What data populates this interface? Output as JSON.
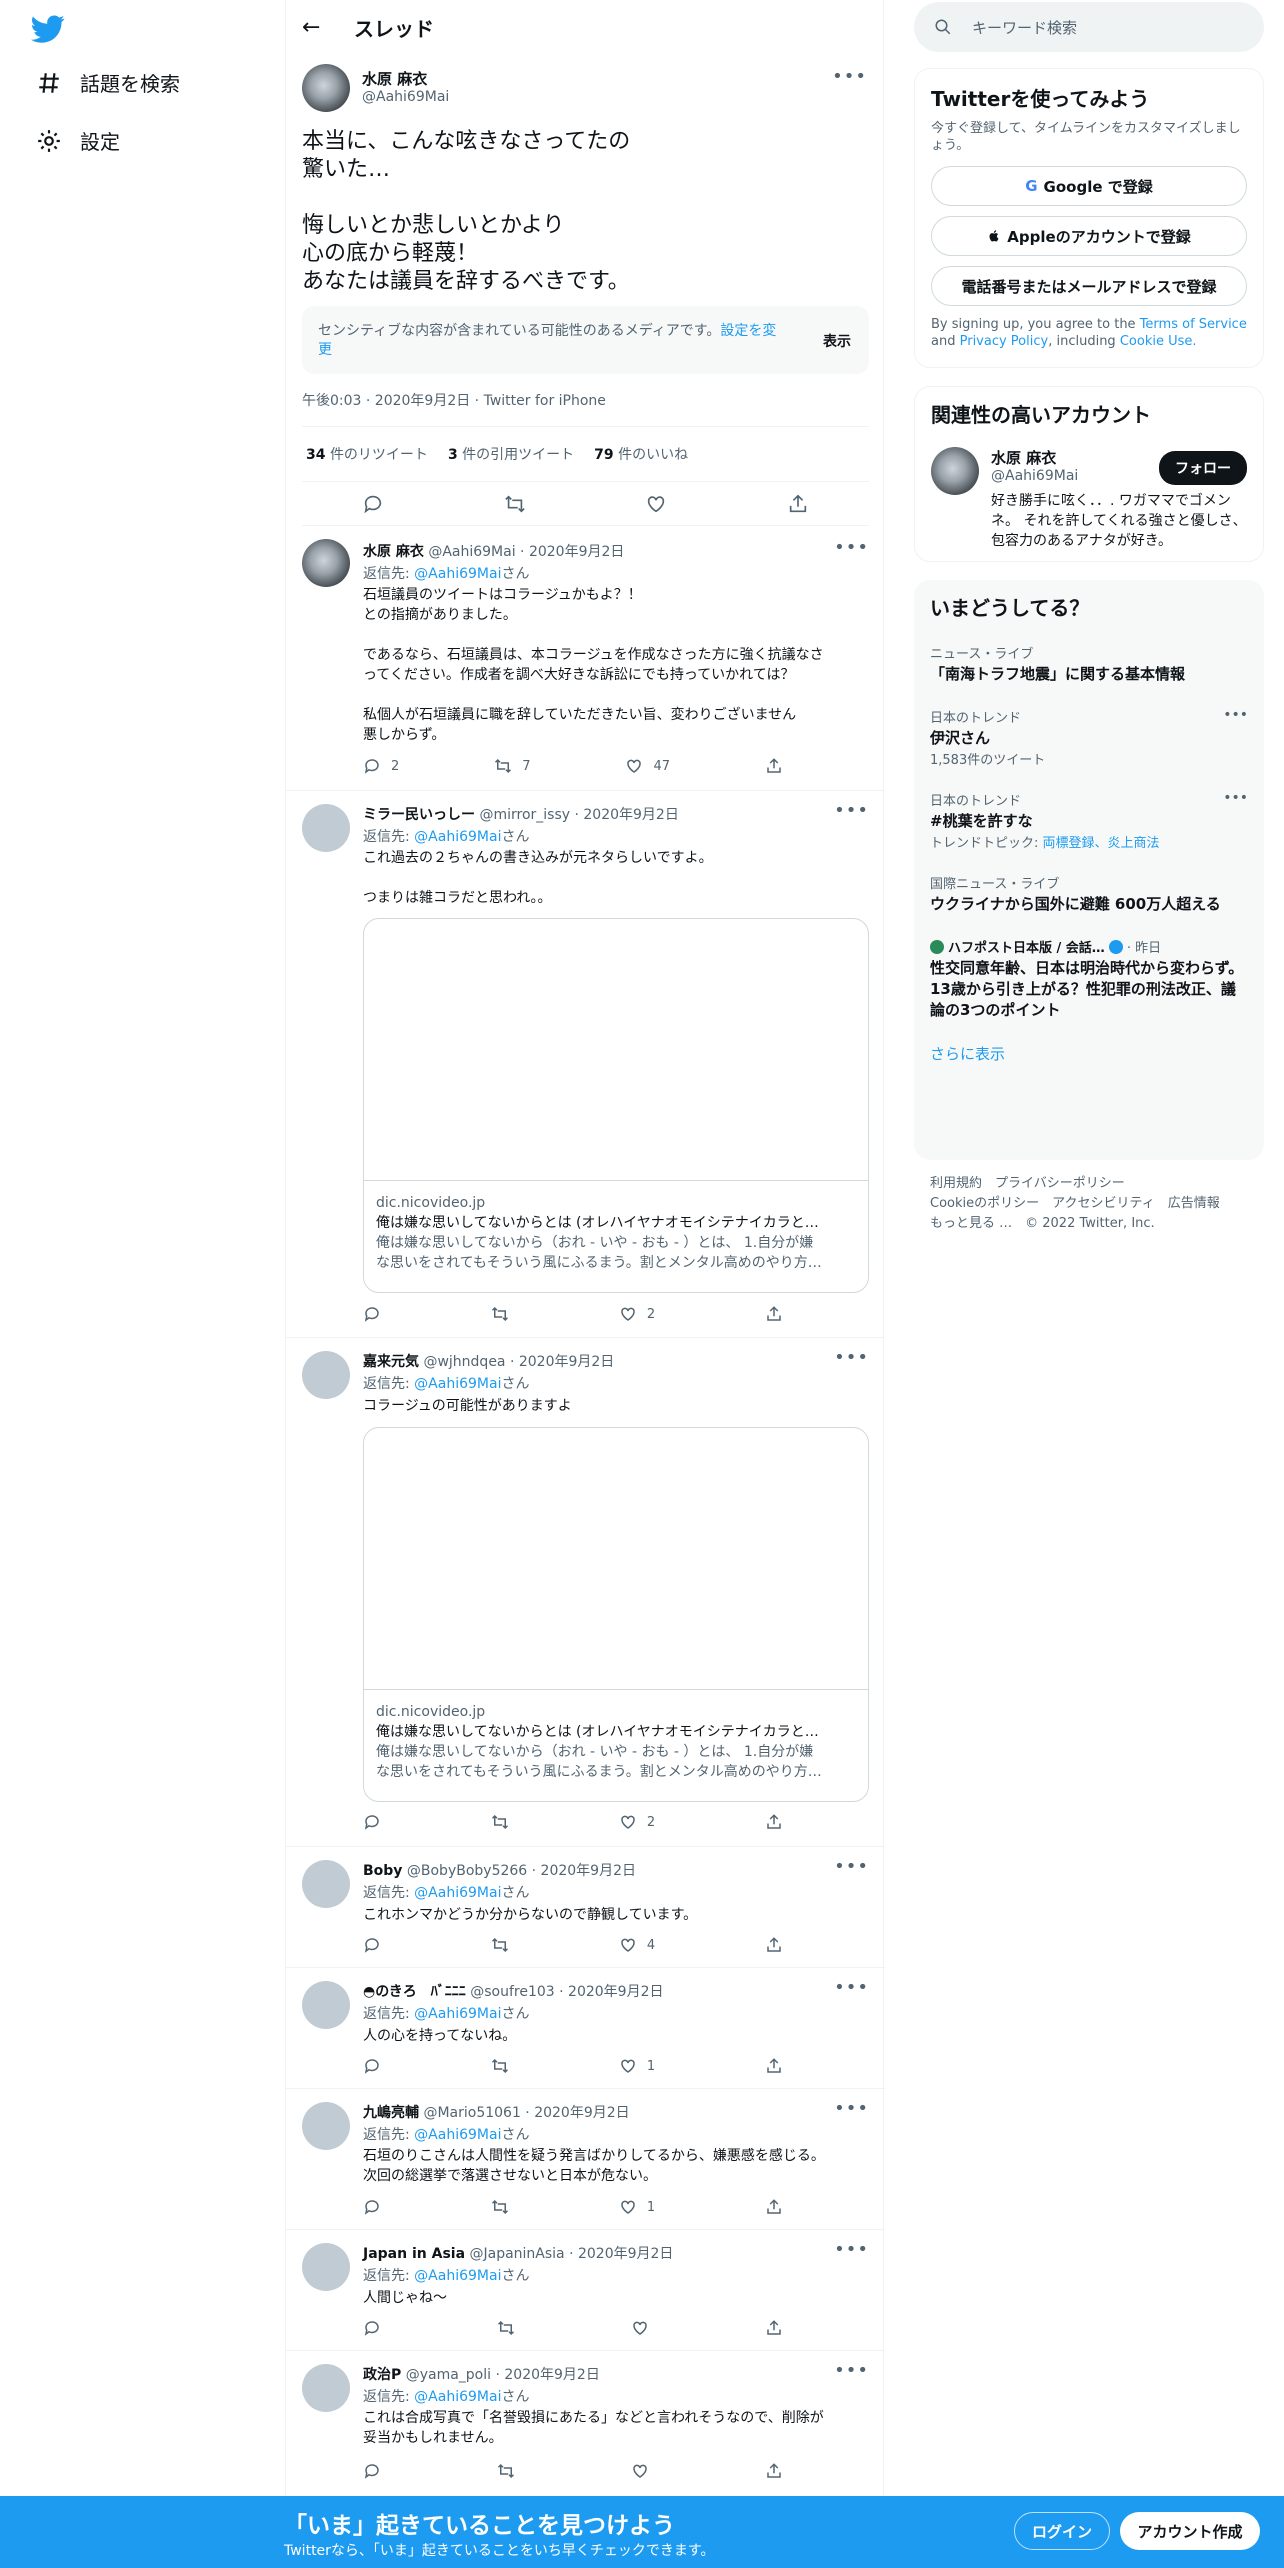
{
  "nav": {
    "explore": "話題を検索",
    "settings": "設定"
  },
  "header": {
    "back": "←",
    "title": "スレッド"
  },
  "main_tweet": {
    "name": "水原 麻衣",
    "handle": "@Aahi69Mai",
    "line1": "本当に、こんな呟きなさってたの",
    "line2": "驚いた…",
    "line3": "悔しいとか悲しいとかより",
    "line4": "心の底から軽蔑！",
    "line5": "あなたは議員を辞するべきです。",
    "sensitive": "センシティブな内容が含まれている可能性のあるメディアです。",
    "sensitive_link": "設定を変更",
    "show": "表示",
    "meta": "午後0:03 · 2020年9月2日 · Twitter for iPhone",
    "rt_count": "34",
    "rt_label": "件のリツイート",
    "qt_count": "3",
    "qt_label": "件の引用ツイート",
    "like_count": "79",
    "like_label": "件のいいね"
  },
  "reply_to": "返信先:",
  "reply_handle": "@Aahi69Mai",
  "reply_suffix": "さん",
  "replies": [
    {
      "name": "水原 麻衣",
      "meta": "@Aahi69Mai · 2020年9月2日",
      "lines": [
        "石垣議員のツイートはコラージュかもよ？！",
        "との指摘がありました。",
        "",
        "であるなら、石垣議員は、本コラージュを作成なさった方に強く抗議なさ",
        "ってください。作成者を調べ大好きな訴訟にでも持っていかれては？",
        "",
        "私個人が石垣議員に職を辞していただきたい旨、変わりございません",
        "悪しからず。"
      ],
      "reply": "2",
      "rt": "7",
      "like": "47"
    },
    {
      "name": "ミラー民いっしー",
      "meta": "@mirror_issy · 2020年9月2日",
      "lines": [
        "これ過去の２ちゃんの書き込みが元ネタらしいですよ。",
        "",
        "つまりは雑コラだと思われ。。"
      ],
      "like": "2"
    },
    {
      "name": "嘉来元気",
      "meta": "@wjhndqea · 2020年9月2日",
      "lines": [
        "コラージュの可能性がありますよ"
      ],
      "like": "2"
    },
    {
      "name": "Boby",
      "meta": "@BobyBoby5266 · 2020年9月2日",
      "lines": [
        "これホンマかどうか分からないので静観しています。"
      ],
      "like": "4"
    },
    {
      "name": "◓のきろ　ﾊﾞﾆﾆﾆ",
      "meta": "@soufre103 · 2020年9月2日",
      "lines": [
        "人の心を持ってないね。"
      ],
      "like": "1"
    },
    {
      "name": "九嶋亮輔",
      "meta": "@Mario51061 · 2020年9月2日",
      "lines": [
        "石垣のりこさんは人間性を疑う発言ばかりしてるから、嫌悪感を感じる。",
        "次回の総選挙で落選させないと日本が危ない。"
      ],
      "like": "1"
    },
    {
      "name": "Japan in Asia",
      "meta": "@JapaninAsia · 2020年9月2日",
      "lines": [
        "人間じゃね〜"
      ]
    },
    {
      "name": "政治P",
      "meta": "@yama_poli · 2020年9月2日",
      "lines": [
        "これは合成写真で「名誉毀損にあたる」などと言われそうなので、削除が",
        "妥当かもしれません。"
      ]
    }
  ],
  "link_card": {
    "domain": "dic.nicovideo.jp",
    "title": "俺は嫌な思いしてないからとは (オレハイヤナオモイシテナイカラと…",
    "desc1": "俺は嫌な思いしてないから（おれ - いや - おも - ）とは、 1.自分が嫌",
    "desc2": "な思いをされてもそういう風にふるまう。割とメンタル高めのやり方…"
  },
  "search": {
    "placeholder": "キーワード検索"
  },
  "signup": {
    "title": "Twitterを使ってみよう",
    "sub": "今すぐ登録して、タイムラインをカスタマイズしましょう。",
    "google": "Google で登録",
    "apple": "Appleのアカウントで登録",
    "phone": "電話番号またはメールアドレスで登録",
    "legal1": "By signing up, you agree to the",
    "tos": "Terms of Service",
    "and": "and",
    "privacy": "Privacy Policy",
    "legal2": ", including",
    "cookie": "Cookie Use."
  },
  "related": {
    "title": "関連性の高いアカウント",
    "name": "水原 麻衣",
    "handle": "@Aahi69Mai",
    "follow": "フォロー",
    "bio": "好き勝手に呟く．．. ワガママでゴメンネ。 それを許してくれる強さと優しさ、包容力のあるアナタが好き。"
  },
  "trends": {
    "title": "いまどうしてる？",
    "items": [
      {
        "cat": "ニュース・ライブ",
        "title": "「南海トラフ地震」に関する基本情報"
      },
      {
        "cat": "日本のトレンド",
        "title": "伊沢さん",
        "sub": "1,583件のツイート"
      },
      {
        "cat": "日本のトレンド",
        "title": "#桃葉を許すな",
        "sub_prefix": "トレンドトピック:",
        "sub_links": "両標登録、炎上商法"
      },
      {
        "cat": "国際ニュース・ライブ",
        "title": "ウクライナから国外に避難 600万人超える"
      },
      {
        "cat": "ハフポスト日本版 / 会話…",
        "cat_suffix": "· 昨日",
        "title": "性交同意年齢、日本は明治時代から変わらず。13歳から引き上がる？性犯罪の刑法改正、議論の3つのポイント"
      }
    ],
    "more": "さらに表示"
  },
  "footer": {
    "l1": "利用規約　プライバシーポリシー",
    "l2": "Cookieのポリシー　アクセシビリティ　広告情報",
    "l3": "もっと見る …　© 2022 Twitter, Inc."
  },
  "banner": {
    "title": "「いま」起きていることを見つけよう",
    "sub": "Twitterなら、「いま」起きていることをいち早くチェックできます。",
    "login": "ログイン",
    "signup": "アカウント作成"
  },
  "colors": {
    "accent": "#1d9bf0",
    "text": "#0f1419",
    "muted": "#536471"
  }
}
